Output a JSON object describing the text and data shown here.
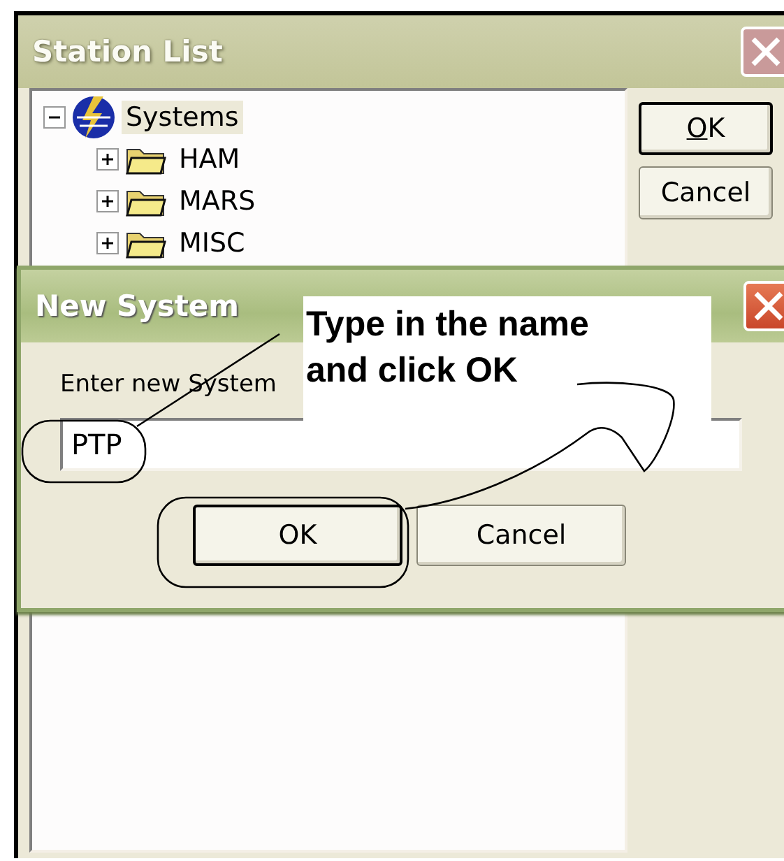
{
  "station_list": {
    "title": "Station List",
    "active": false,
    "tree": [
      {
        "label": "Systems",
        "kind": "system",
        "expanded": true,
        "selected": true,
        "children": [
          {
            "label": "HAM",
            "kind": "folder",
            "expanded": false,
            "selected": false
          },
          {
            "label": "MARS",
            "kind": "folder",
            "expanded": false,
            "selected": false
          },
          {
            "label": "MISC",
            "kind": "folder",
            "expanded": false,
            "selected": false
          }
        ]
      }
    ],
    "buttons": [
      {
        "label": "OK",
        "mnemonic": true,
        "default": true
      },
      {
        "label": "Cancel",
        "mnemonic": false,
        "default": false
      }
    ]
  },
  "new_system": {
    "title": "New System",
    "active": true,
    "prompt": "Enter new System",
    "value": "PTP",
    "buttons": [
      {
        "label": "OK",
        "default": true
      },
      {
        "label": "Cancel",
        "default": false
      }
    ]
  },
  "callout": {
    "text": "Type in the name and click OK"
  }
}
